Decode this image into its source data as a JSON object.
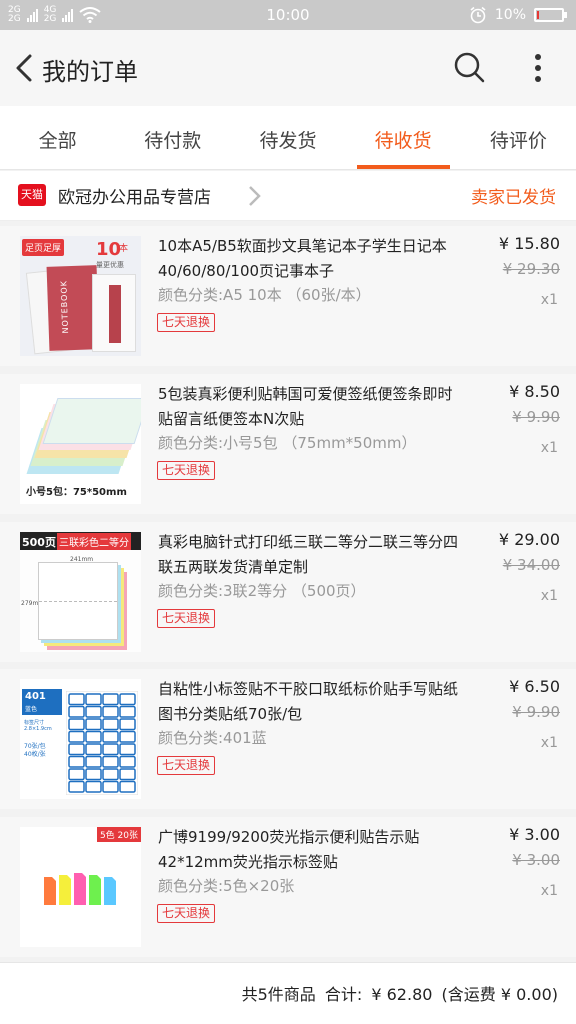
{
  "status_bar": {
    "net1": "2G",
    "net2": "2G",
    "net3": "4G",
    "time": "10:00",
    "battery": "10%",
    "battery_level": 0.1
  },
  "header": {
    "title": "我的订单"
  },
  "tabs": [
    {
      "label": "全部"
    },
    {
      "label": "待付款"
    },
    {
      "label": "待发货"
    },
    {
      "label": "待收货"
    },
    {
      "label": "待评价"
    }
  ],
  "active_tab": "待收货",
  "store": {
    "badge": "天猫",
    "name": "欧冠办公用品专营店",
    "status": "卖家已发货"
  },
  "items": [
    {
      "name": "10本A5/B5软面抄文具笔记本子学生日记本40/60/80/100页记事本子",
      "variant": "颜色分类:A5 10本 （60张/本）",
      "badge": "七天退换",
      "price": "¥ 15.80",
      "original_price": "¥ 29.30",
      "qty": "x1",
      "thumb_tag1": "足页足厚",
      "thumb_tag2": "10",
      "thumb_tag3": "本",
      "thumb_tag4": "量更优惠",
      "thumb_cover": "NOTEBOOK"
    },
    {
      "name": "5包装真彩便利贴韩国可爱便签纸便签条即时贴留言纸便签本N次贴",
      "variant": "颜色分类:小号5包 （75mm*50mm）",
      "badge": "七天退换",
      "price": "¥ 8.50",
      "original_price": "¥ 9.90",
      "qty": "x1",
      "thumb_caption": "小号5包：75*50mm"
    },
    {
      "name": "真彩电脑针式打印纸三联二等分二联三等分四联五两联发货清单定制",
      "variant": "颜色分类:3联2等分 （500页）",
      "badge": "七天退换",
      "price": "¥ 29.00",
      "original_price": "¥ 34.00",
      "qty": "x1",
      "thumb_tag1": "500页",
      "thumb_tag2": "三联彩色二等分",
      "thumb_width": "241mm",
      "thumb_height": "279mm"
    },
    {
      "name": "自粘性小标签贴不干胶口取纸标价贴手写贴纸图书分类贴纸70张/包",
      "variant": "颜色分类:401蓝",
      "badge": "七天退换",
      "price": "¥ 6.50",
      "original_price": "¥ 9.90",
      "qty": "x1",
      "thumb_code": "401",
      "thumb_color": "蓝色",
      "thumb_spec1": "标签尺寸",
      "thumb_spec2": "2.8×1.9cm",
      "thumb_spec3": "70张/包",
      "thumb_spec4": "40枚/张"
    },
    {
      "name": "广博9199/9200荧光指示便利贴告示贴42*12mm荧光指示标签贴",
      "variant": "颜色分类:5色×20张",
      "badge": "七天退换",
      "price": "¥ 3.00",
      "original_price": "¥ 3.00",
      "qty": "x1",
      "thumb_tag": "5色 20张"
    }
  ],
  "summary": {
    "count_text": "共5件商品",
    "total_label": "合计:",
    "total": "¥ 62.80",
    "shipping": "(含运费 ¥ 0.00)"
  },
  "colors": {
    "accent": "#f25c1c",
    "badge": "#e4393c",
    "tmall": "#e4101e"
  }
}
